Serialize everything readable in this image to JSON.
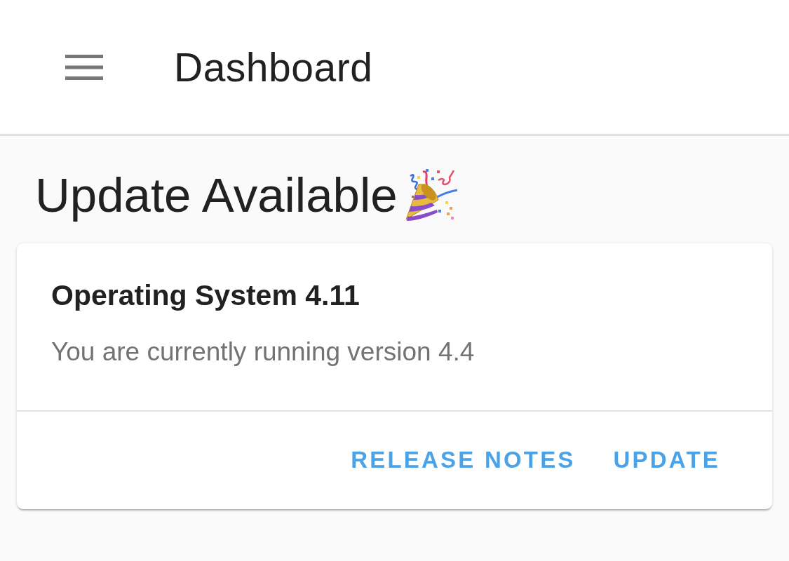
{
  "app_bar": {
    "title": "Dashboard"
  },
  "heading": {
    "text": "Update Available"
  },
  "update_card": {
    "title": "Operating System 4.11",
    "description": "You are currently running version 4.4",
    "actions": [
      {
        "label": "RELEASE NOTES"
      },
      {
        "label": "UPDATE"
      }
    ]
  }
}
